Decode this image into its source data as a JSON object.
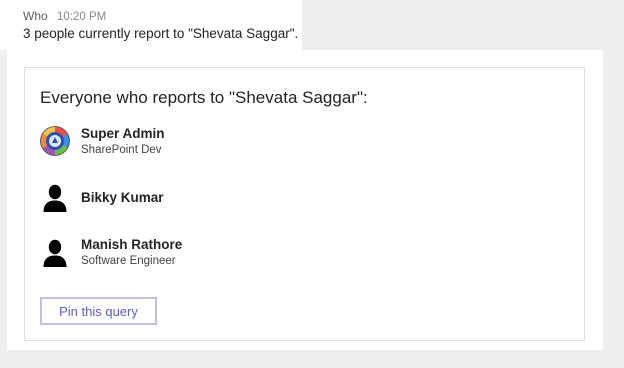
{
  "message": {
    "sender": "Who",
    "time": "10:20 PM",
    "summary": "3 people currently report to \"Shevata Saggar\"."
  },
  "card": {
    "title": "Everyone who reports to \"Shevata Saggar\":",
    "people": [
      {
        "name": "Super Admin",
        "role": "SharePoint Dev",
        "avatar": "profile-photo-avatar"
      },
      {
        "name": "Bikky Kumar",
        "role": "",
        "avatar": "person-silhouette-icon"
      },
      {
        "name": "Manish Rathore",
        "role": "Software Engineer",
        "avatar": "person-silhouette-icon"
      }
    ],
    "pin_label": "Pin this query"
  },
  "colors": {
    "background": "#f0efee",
    "accent": "#5b5fc7",
    "button_border": "#c3c0e6"
  }
}
